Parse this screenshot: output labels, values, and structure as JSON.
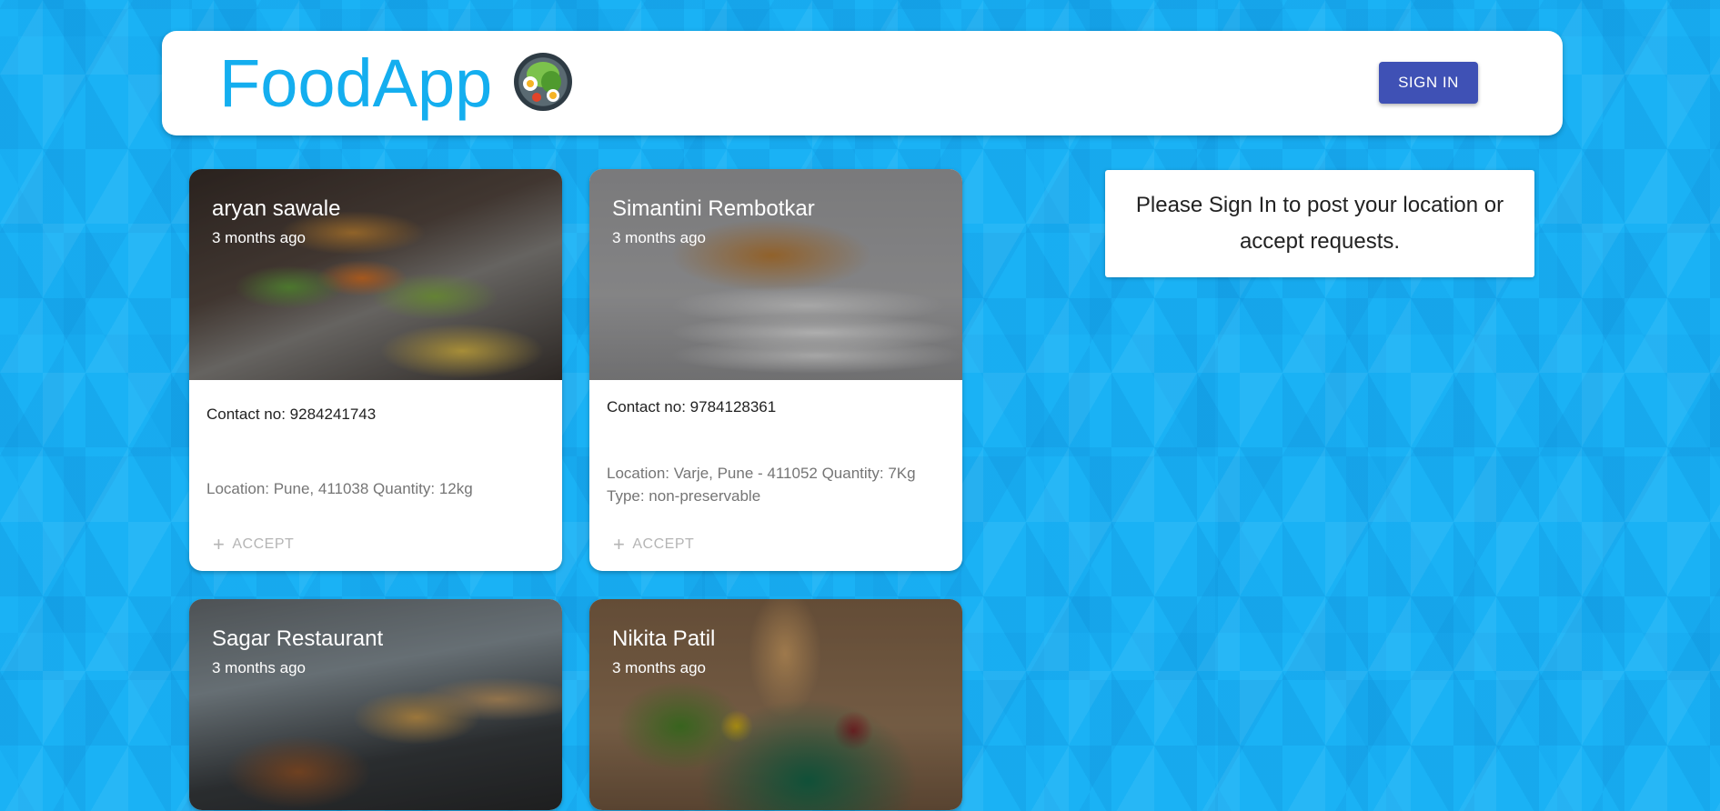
{
  "header": {
    "app_title": "FoodApp",
    "logo_icon": "food-bowl-logo",
    "signin_label": "SIGN IN"
  },
  "signin_note": {
    "text": "Please Sign In to post your location or accept requests."
  },
  "cards": [
    {
      "name": "aryan sawale",
      "time": "3 months ago",
      "contact": "Contact no: 9284241743",
      "location": "Location: Pune, 411038 Quantity: 12kg",
      "accept_label": "ACCEPT"
    },
    {
      "name": "Simantini Rembotkar",
      "time": "3 months ago",
      "contact": "Contact no: 9784128361",
      "location": "Location: Varje, Pune - 411052 Quantity: 7Kg Type: non-preservable",
      "accept_label": "ACCEPT"
    },
    {
      "name": "Sagar Restaurant",
      "time": "3 months ago"
    },
    {
      "name": "Nikita Patil",
      "time": "3 months ago"
    }
  ],
  "colors": {
    "background": "#1ab2f5",
    "title": "#14aeef",
    "signin_button": "#3f51b5",
    "accept_disabled": "#b5b5b5"
  }
}
